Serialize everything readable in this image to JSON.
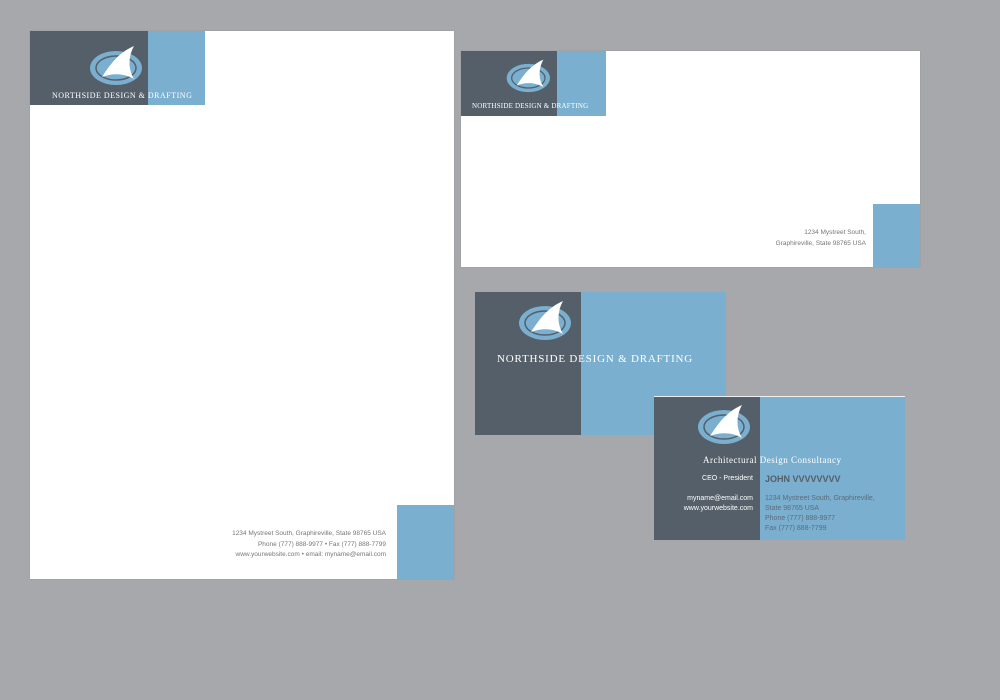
{
  "brand": {
    "name": "NORTHSIDE DESIGN & DRAFTING",
    "tagline": "Architectural Design Consultancy"
  },
  "colors": {
    "dark": "#545f69",
    "blue": "#7aafcf",
    "background": "#a6a8ab"
  },
  "letterhead": {
    "address_line": "1234 Mystreet South, Graphireville, State 98765 USA",
    "phone_line": "Phone (777) 888-9977  •  Fax (777) 888-7799",
    "web_line": "www.yourwebsite.com  •  email: myname@email.com"
  },
  "envelope": {
    "address_line1": "1234 Mystreet South,",
    "address_line2": "Graphireville, State 98765 USA"
  },
  "business_card": {
    "title": "CEO - President",
    "name": "JOHN VVVVVVVV",
    "email": "myname@email.com",
    "website": "www.yourwebsite.com",
    "address_line1": "1234 Mystreet South, Graphireville,",
    "address_line2": "State 98765 USA",
    "phone": "Phone (777) 888-9977",
    "fax": "Fax (777) 888-7799"
  }
}
